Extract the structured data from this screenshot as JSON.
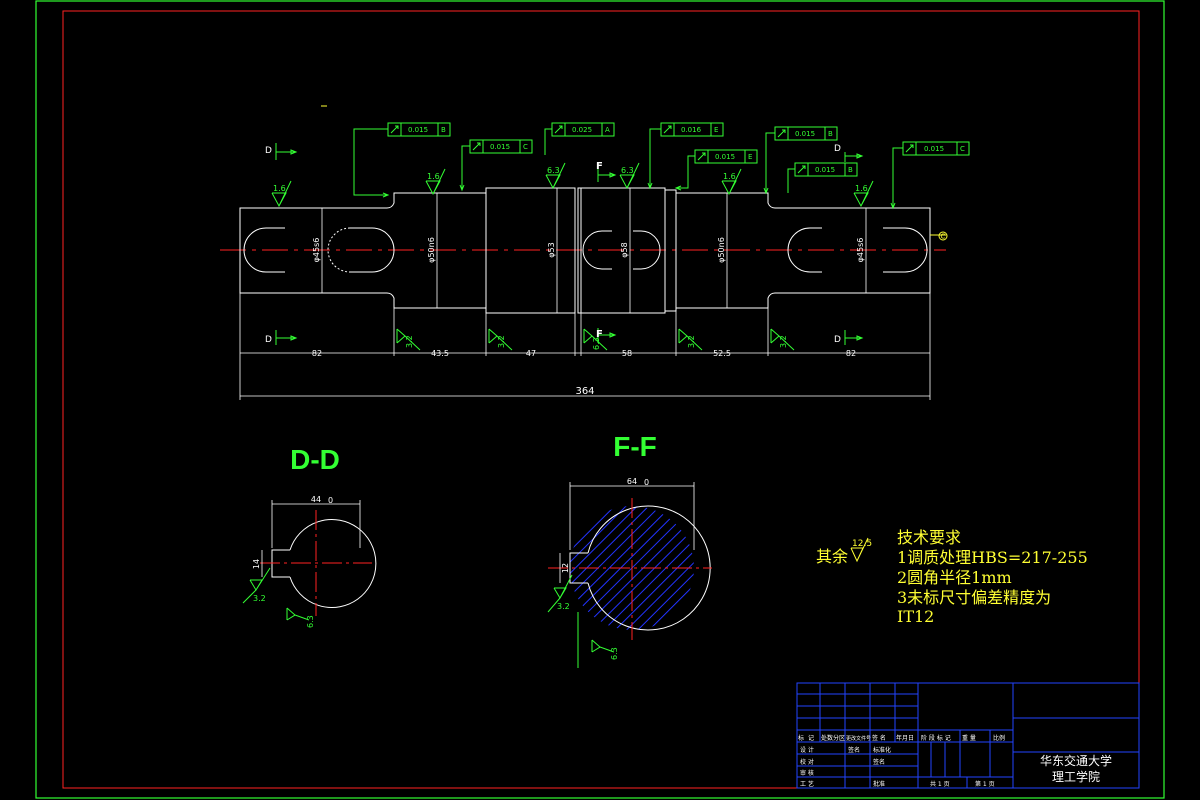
{
  "colors": {
    "background": "#000000",
    "frame_outer": "#33ff33",
    "frame_inner": "#ff2222",
    "outline": "#ffffff",
    "centerline": "#ff2222",
    "annotation": "#33ff33",
    "note_text": "#ffff33",
    "hatch": "#2233ff"
  },
  "section_labels": {
    "d_left_top": "D",
    "d_left_bottom": "D",
    "d_right_top": "D",
    "d_right_bottom": "D",
    "f_top": "F",
    "f_bottom": "F"
  },
  "tolerance_frames": [
    {
      "value": "0.015",
      "datum": "B"
    },
    {
      "value": "0.015",
      "datum": "C"
    },
    {
      "value": "0.025",
      "datum": "A"
    },
    {
      "value": "0.016",
      "datum": "E"
    },
    {
      "value": "0.015",
      "datum": "E"
    },
    {
      "value": "0.015",
      "datum": "B"
    },
    {
      "value": "0.015",
      "datum": "B"
    },
    {
      "value": "0.015",
      "datum": "C"
    }
  ],
  "roughness_top": [
    "1.6",
    "1.6",
    "6.3",
    "6.3",
    "1.6",
    "1.6"
  ],
  "roughness_bottom": [
    "3.2",
    "3.2",
    "6.3",
    "3.2",
    "3.2"
  ],
  "diameters": [
    "φ45s6",
    "φ50n6",
    "φ53",
    "φ58",
    "φ50n6",
    "φ45s6"
  ],
  "segment_lengths": [
    "82",
    "43.5",
    "47",
    "58",
    "52.5",
    "82"
  ],
  "total_length": "364",
  "datum_symbol": "C",
  "section_views": {
    "dd": {
      "title": "D-D",
      "width_dim": "44",
      "width_dim_sup": "0",
      "key_dim": "14",
      "rough_key": "3.2",
      "rough_outer": "6.3"
    },
    "ff": {
      "title": "F-F",
      "width_dim": "64",
      "width_dim_sup": "0",
      "key_dim": "12",
      "rough_key": "3.2",
      "rough_outer": "6.3"
    }
  },
  "roughness_general": {
    "label": "其余",
    "value": "12.5"
  },
  "tech_requirements": {
    "title": "技术要求",
    "items": [
      "1调质处理HBS=217-255",
      "2圆角半径1mm",
      "3未标尺寸偏差精度为",
      "IT12"
    ]
  },
  "title_block": {
    "header_row": [
      "标",
      "记",
      "处数",
      "分区",
      "更改文件号",
      "签 名",
      "年月日"
    ],
    "row_design": [
      "设 计",
      "签名",
      "标准化"
    ],
    "row_check": [
      "校 对",
      "",
      "签名"
    ],
    "row_review": [
      "审 核",
      "",
      ""
    ],
    "row_process": [
      "工 艺",
      "",
      "批准"
    ],
    "stage_labels": [
      "阶 段 标 记",
      "重 量",
      "比例"
    ],
    "sheets": [
      "共 1 页",
      "第 1 页"
    ],
    "school_line1": "华东交通大学",
    "school_line2": "理工学院"
  }
}
